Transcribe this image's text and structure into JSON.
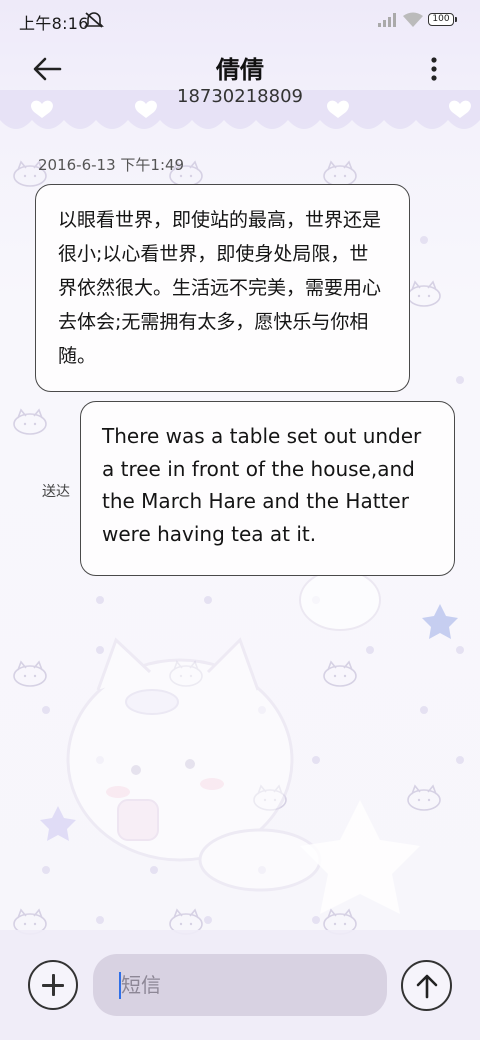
{
  "status_bar": {
    "time": "上午8:16",
    "battery": "100",
    "icons": [
      "mute-icon",
      "signal-icon",
      "wifi-icon",
      "battery-icon"
    ]
  },
  "header": {
    "contact_name": "倩倩",
    "contact_number": "18730218809",
    "icons": [
      "back-arrow-icon",
      "more-vert-icon"
    ]
  },
  "conversation": {
    "timestamp": "2016-6-13 下午1:49",
    "messages": [
      {
        "direction": "incoming",
        "text": "以眼看世界，即使站的最高，世界还是很小;以心看世界，即使身处局限，世界依然很大。生活远不完美，需要用心去体会;无需拥有太多，愿快乐与你相随。"
      },
      {
        "direction": "outgoing",
        "text": "There was a table set out under a tree in front of the house,and the March Hare and the Hatter were having tea at it.",
        "status": "送达"
      }
    ]
  },
  "composer": {
    "placeholder": "短信",
    "value": "",
    "icons": [
      "plus-icon",
      "send-arrow-up-icon"
    ]
  },
  "colors": {
    "background": "#f7f6fb",
    "header_tint": "#eeeaf9",
    "bubble_fill": "#fefdfe",
    "bubble_border": "#4a4a4a",
    "input_fill": "#d8d2e2",
    "cursor": "#2f6fe8"
  }
}
